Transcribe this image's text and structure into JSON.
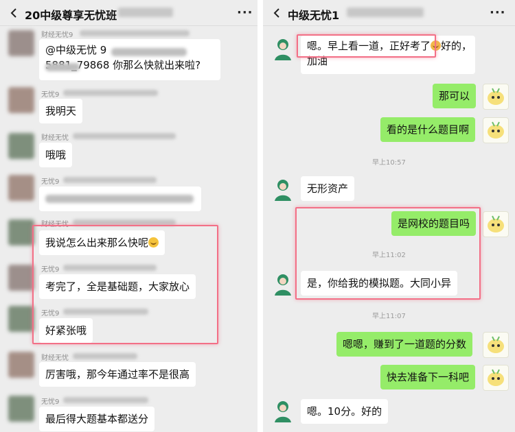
{
  "left": {
    "title": "20中级尊享无忧班",
    "more": "···",
    "messages": [
      {
        "name": "财经无忧9",
        "lines": [
          "@中级无忧 9",
          "5881_79868  你那么快就出来啦?"
        ]
      },
      {
        "name": "无忧9",
        "text": "我明天"
      },
      {
        "name": "财经无忧",
        "text": "哦哦"
      },
      {
        "name": "无忧9",
        "text": ""
      },
      {
        "name": "财经无忧",
        "text": "我说怎么出来那么快呢"
      },
      {
        "name": "无忧9",
        "text": "考完了，全是基础题，大家放心"
      },
      {
        "name": "无忧9",
        "text": "好紧张哦"
      },
      {
        "name": "财经无忧",
        "text": "厉害哦，那今年通过率不是很高"
      },
      {
        "name": "无忧9",
        "text": "最后得大题基本都送分"
      }
    ]
  },
  "right": {
    "title": "中级无忧1",
    "more": "···",
    "messages": [
      {
        "lines": [
          "嗯。早上看一道，正好考了",
          "好的，",
          "加油"
        ]
      },
      {
        "text": "那可以"
      },
      {
        "text": "看的是什么题目啊"
      },
      {
        "time": "早上10:57"
      },
      {
        "text": "无形资产"
      },
      {
        "text": "是网校的题目吗"
      },
      {
        "time": "早上11:02"
      },
      {
        "text": "是，你给我的模拟题。大同小异"
      },
      {
        "time": "早上11:07"
      },
      {
        "text": "嗯嗯，赚到了一道题的分数"
      },
      {
        "text": "快去准备下一科吧"
      },
      {
        "text": "嗯。10分。好的"
      }
    ]
  },
  "colors": {
    "sent_bubble": "#95ec69",
    "recv_bubble": "#ffffff",
    "highlight": "#f36f86",
    "background": "#ededed"
  },
  "icons": [
    "back-icon",
    "more-icon",
    "avatar",
    "laugh-emoji",
    "thinking-emoji"
  ]
}
